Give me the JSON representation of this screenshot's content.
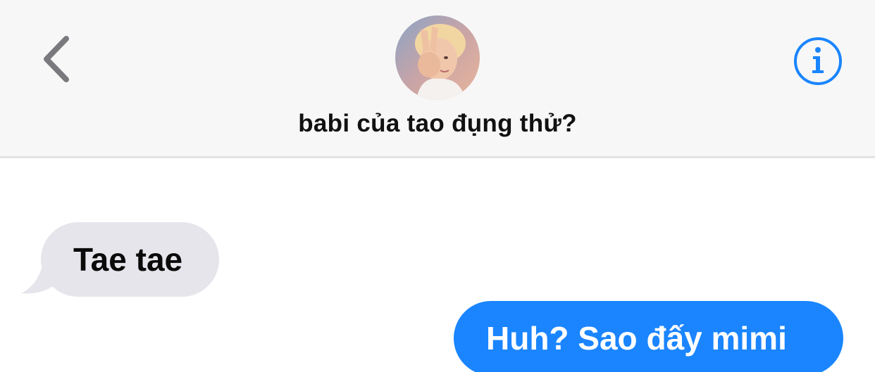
{
  "header": {
    "contact_name": "babi của tao đụng thử?",
    "back_icon": "chevron-left-icon",
    "info_icon": "info-icon",
    "accent_color": "#1a85ff"
  },
  "messages": [
    {
      "direction": "received",
      "text": "Tae tae",
      "bubble_color": "#e6e5eb"
    },
    {
      "direction": "sent",
      "text": "Huh? Sao đấy mimi",
      "bubble_color": "#1a85ff"
    }
  ]
}
